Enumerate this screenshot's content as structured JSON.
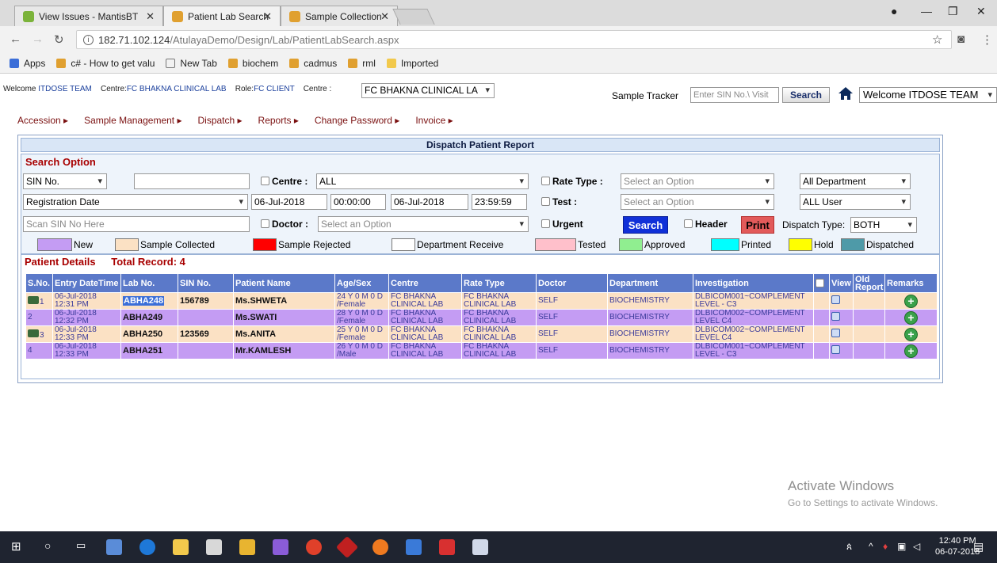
{
  "browser": {
    "tabs": [
      {
        "label": "View Issues - MantisBT"
      },
      {
        "label": "Patient Lab Search"
      },
      {
        "label": "Sample Collection"
      }
    ],
    "url_host": "182.71.102.124",
    "url_path": "/AtulayaDemo/Design/Lab/PatientLabSearch.aspx",
    "bookmarks": [
      "Apps",
      "c# - How to get valu",
      "New Tab",
      "biochem",
      "cadmus",
      "rml",
      "Imported"
    ]
  },
  "header": {
    "welcome_label": "Welcome",
    "welcome_user": "ITDOSE TEAM",
    "centre_label": "Centre:",
    "centre_value": "FC BHAKNA CLINICAL LAB",
    "role_label": "Role:",
    "role_value": "FC CLIENT",
    "centre_select_label": "Centre :",
    "centre_select_value": "FC BHAKNA CLINICAL LA",
    "tracker_label": "Sample Tracker",
    "tracker_placeholder": "Enter SIN No.\\ Visit",
    "tracker_button": "Search",
    "user_select": "Welcome ITDOSE TEAM"
  },
  "menu": [
    "Accession ▸",
    "Sample Management ▸",
    "Dispatch ▸",
    "Reports ▸",
    "Change Password ▸",
    "Invoice ▸"
  ],
  "panel": {
    "title": "Dispatch Patient Report",
    "search_title": "Search Option",
    "sin_select": "SIN No.",
    "centre_label": "Centre :",
    "centre_value": "ALL",
    "rate_type_label": "Rate Type :",
    "rate_type_placeholder": "Select an Option",
    "department_value": "All Department",
    "date_type": "Registration Date",
    "from_date": "06-Jul-2018",
    "from_time": "00:00:00",
    "to_date": "06-Jul-2018",
    "to_time": "23:59:59",
    "test_label": "Test :",
    "test_placeholder": "Select an Option",
    "user_value": "ALL User",
    "scan_placeholder": "Scan SIN No Here",
    "doctor_label": "Doctor :",
    "doctor_placeholder": "Select an Option",
    "urgent_label": "Urgent",
    "search_button": "Search",
    "header_label": "Header",
    "print_button": "Print",
    "dispatch_type_label": "Dispatch Type:",
    "dispatch_type_value": "BOTH"
  },
  "legend": [
    {
      "label": "New",
      "color": "#c49cf3"
    },
    {
      "label": "Sample Collected",
      "color": "#fbe1c4"
    },
    {
      "label": "Sample Rejected",
      "color": "#ff0000"
    },
    {
      "label": "Department Receive",
      "color": "#ffffff"
    },
    {
      "label": "Tested",
      "color": "#ffc0cb"
    },
    {
      "label": "Approved",
      "color": "#90ee90"
    },
    {
      "label": "Printed",
      "color": "#00ffff"
    },
    {
      "label": "Hold",
      "color": "#ffff00"
    },
    {
      "label": "Dispatched",
      "color": "#4e9aa8"
    }
  ],
  "details": {
    "title": "Patient Details",
    "total_label": "Total Record: 4",
    "columns": [
      "S.No.",
      "Entry DateTime",
      "Lab No.",
      "SIN No.",
      "Patient Name",
      "Age/Sex",
      "Centre",
      "Rate Type",
      "Doctor",
      "Department",
      "Investigation",
      "",
      "View",
      "Old Report",
      "Remarks"
    ],
    "rows": [
      {
        "sno": "1",
        "date": "06-Jul-2018",
        "time": "12:31 PM",
        "lab": "ABHA248",
        "sin": "156789",
        "name": "Ms.SHWETA",
        "age": "24 Y 0 M 0 D",
        "sex": "/Female",
        "centre1": "FC BHAKNA",
        "centre2": "CLINICAL LAB",
        "rate1": "FC BHAKNA",
        "rate2": "CLINICAL LAB",
        "doctor": "SELF",
        "dept": "BIOCHEMISTRY",
        "inv1": "DLBICOM001~COMPLEMENT",
        "inv2": "LEVEL - C3"
      },
      {
        "sno": "2",
        "date": "06-Jul-2018",
        "time": "12:32 PM",
        "lab": "ABHA249",
        "sin": "",
        "name": "Ms.SWATI",
        "age": "28 Y 0 M 0 D",
        "sex": "/Female",
        "centre1": "FC BHAKNA",
        "centre2": "CLINICAL LAB",
        "rate1": "FC BHAKNA",
        "rate2": "CLINICAL LAB",
        "doctor": "SELF",
        "dept": "BIOCHEMISTRY",
        "inv1": "DLBICOM002~COMPLEMENT",
        "inv2": "LEVEL C4"
      },
      {
        "sno": "3",
        "date": "06-Jul-2018",
        "time": "12:33 PM",
        "lab": "ABHA250",
        "sin": "123569",
        "name": "Ms.ANITA",
        "age": "25 Y 0 M 0 D",
        "sex": "/Female",
        "centre1": "FC BHAKNA",
        "centre2": "CLINICAL LAB",
        "rate1": "FC BHAKNA",
        "rate2": "CLINICAL LAB",
        "doctor": "SELF",
        "dept": "BIOCHEMISTRY",
        "inv1": "DLBICOM002~COMPLEMENT",
        "inv2": "LEVEL C4"
      },
      {
        "sno": "4",
        "date": "06-Jul-2018",
        "time": "12:33 PM",
        "lab": "ABHA251",
        "sin": "",
        "name": "Mr.KAMLESH",
        "age": "26 Y 0 M 0 D",
        "sex": "/Male",
        "centre1": "FC BHAKNA",
        "centre2": "CLINICAL LAB",
        "rate1": "FC BHAKNA",
        "rate2": "CLINICAL LAB",
        "doctor": "SELF",
        "dept": "BIOCHEMISTRY",
        "inv1": "DLBICOM001~COMPLEMENT",
        "inv2": "LEVEL - C3"
      }
    ]
  },
  "watermark": {
    "line1": "Activate Windows",
    "line2": "Go to Settings to activate Windows."
  },
  "taskbar": {
    "time": "12:40 PM",
    "date": "06-07-2018"
  }
}
